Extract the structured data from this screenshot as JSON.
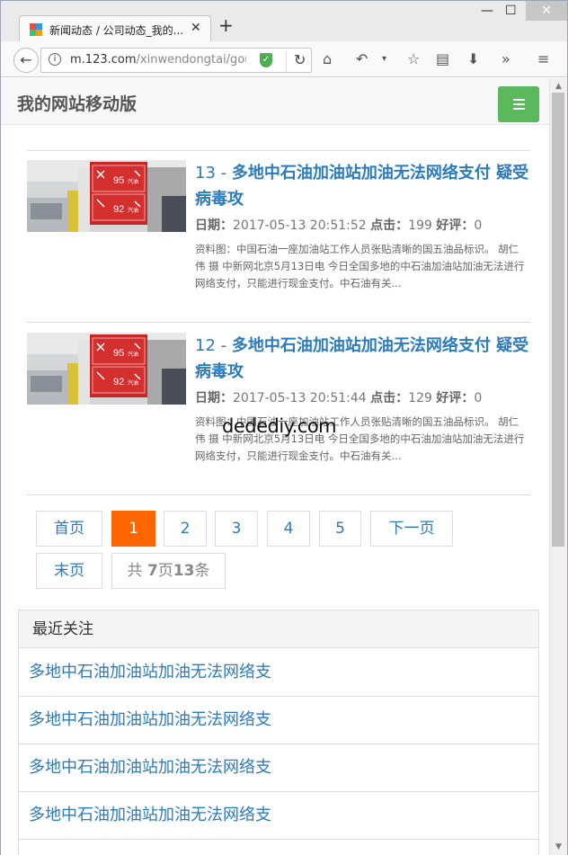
{
  "browser": {
    "tab_title": "新闻动态 / 公司动态_我的...",
    "tab_close": "✕",
    "new_tab": "+",
    "url_host": "m.123.com",
    "url_path": "/xinwendongtai/gong",
    "win_minimize": "—",
    "win_maximize": "☐",
    "win_close": "✕"
  },
  "site": {
    "title": "我的网站移动版"
  },
  "articles": [
    {
      "num": "13 - ",
      "title": "多地中石油加油站加油无法网络支付 疑受病毒攻",
      "date_label": "日期：",
      "date": "2017-05-13 20:51:52",
      "clicks_label": "点击：",
      "clicks": "199",
      "reviews_label": "好评：",
      "reviews": "0",
      "desc": "资料图：中国石油一座加油站工作人员张贴清晰的国五油品标识。 胡仁伟 摄 中新网北京5月13日电 今日全国多地的中石油加油站加油无法进行网络支付，只能进行现金支付。中石油有关..."
    },
    {
      "num": "12 - ",
      "title": "多地中石油加油站加油无法网络支付 疑受病毒攻",
      "date_label": "日期：",
      "date": "2017-05-13 20:51:44",
      "clicks_label": "点击：",
      "clicks": "129",
      "reviews_label": "好评：",
      "reviews": "0",
      "desc": "资料图：中国石油一座加油站工作人员张贴清晰的国五油品标识。 胡仁伟 摄 中新网北京5月13日电 今日全国多地的中石油加油站加油无法进行网络支付，只能进行现金支付。中石油有关..."
    }
  ],
  "thumb_sign": {
    "price1": "95",
    "price2": "92",
    "unit": "汽油"
  },
  "pager": {
    "first": "首页",
    "pages": [
      "1",
      "2",
      "3",
      "4",
      "5"
    ],
    "next": "下一页",
    "last": "末页",
    "info_prefix": "共 ",
    "total_pages": "7",
    "info_mid": "页",
    "total_items": "13",
    "info_suffix": "条"
  },
  "recent": {
    "heading": "最近关注",
    "items": [
      "多地中石油加油站加油无法网络支",
      "多地中石油加油站加油无法网络支",
      "多地中石油加油站加油无法网络支",
      "多地中石油加油站加油无法网络支"
    ]
  },
  "watermark": "dedediy.com",
  "colors": {
    "link": "#2b7bbe",
    "active_page": "#ff6600",
    "menu_button": "#5cb85c"
  }
}
